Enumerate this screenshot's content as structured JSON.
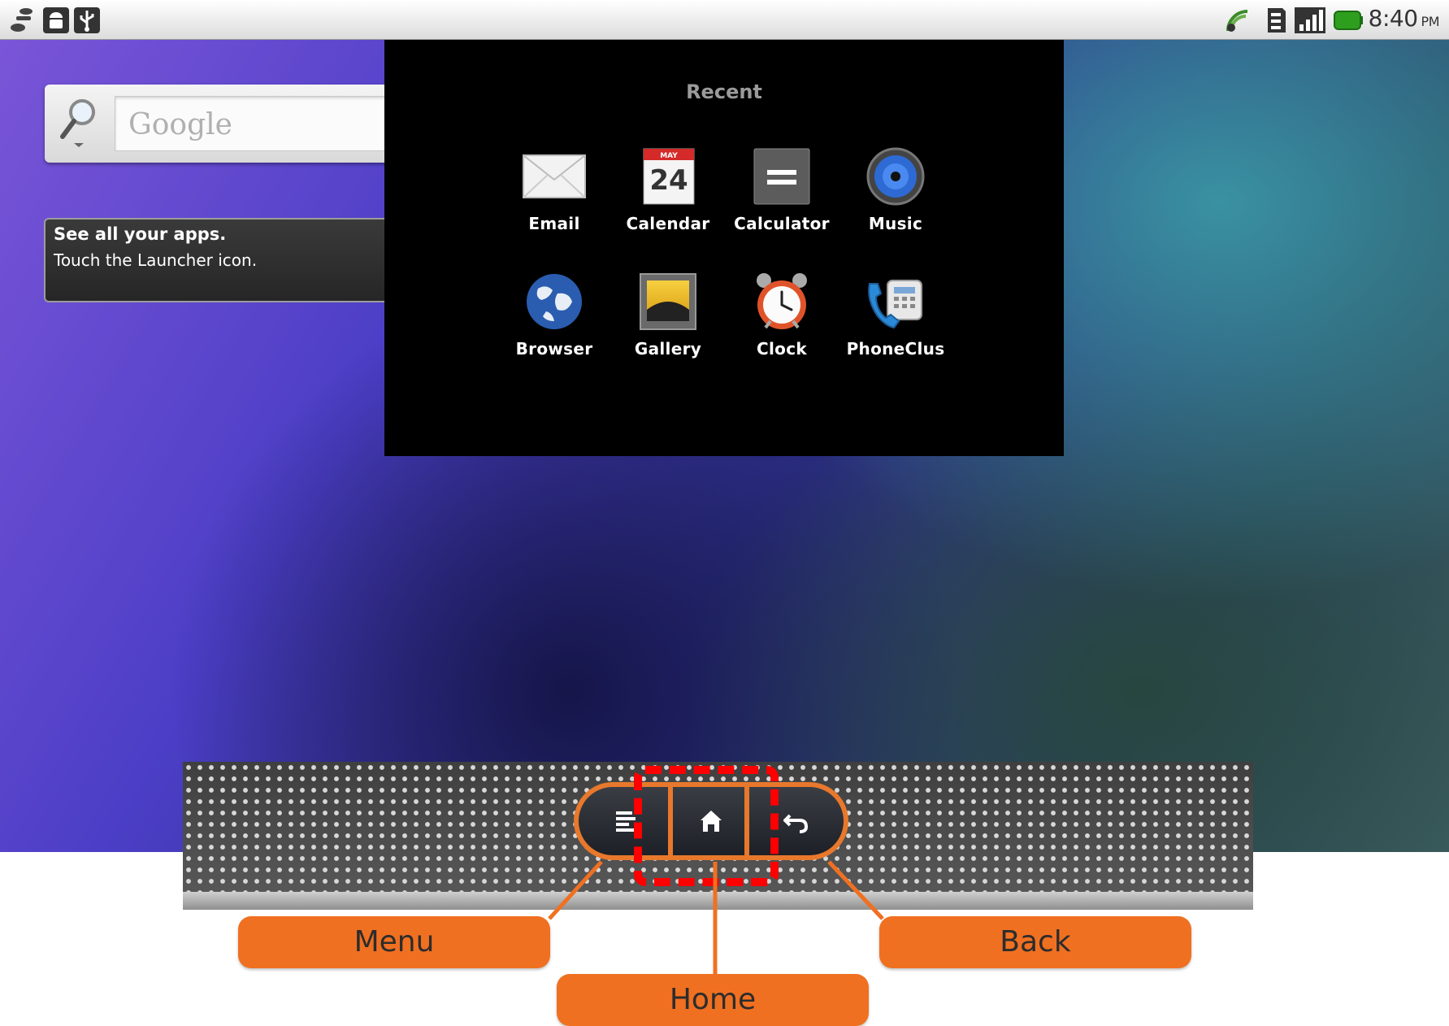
{
  "statusbar": {
    "time": "8:40",
    "ampm": "PM",
    "left_icons": [
      "usb-debug-icon",
      "android-icon",
      "usb-icon"
    ],
    "right_icons": [
      "wifi-signal-icon",
      "sd-card-icon",
      "cell-signal-icon",
      "battery-icon"
    ]
  },
  "search_widget": {
    "placeholder": "Google"
  },
  "tip": {
    "title": "See all your apps.",
    "body": "Touch the Launcher icon."
  },
  "recent": {
    "title": "Recent",
    "apps": [
      {
        "label": "Email",
        "icon": "email-icon"
      },
      {
        "label": "Calendar",
        "icon": "calendar-icon",
        "day": "24",
        "month": "MAY"
      },
      {
        "label": "Calculator",
        "icon": "calculator-icon"
      },
      {
        "label": "Music",
        "icon": "music-icon"
      },
      {
        "label": "Browser",
        "icon": "globe-icon"
      },
      {
        "label": "Gallery",
        "icon": "gallery-icon"
      },
      {
        "label": "Clock",
        "icon": "alarm-clock-icon"
      },
      {
        "label": "PhoneClus",
        "icon": "phone-icon"
      }
    ]
  },
  "device_buttons": {
    "menu_icon": "menu-icon",
    "home_icon": "home-icon",
    "back_icon": "back-icon"
  },
  "callouts": {
    "menu": "Menu",
    "home": "Home",
    "back": "Back"
  },
  "colors": {
    "accent_orange": "#f07021",
    "highlight_red": "#ff0000",
    "dialog_bg": "#000000"
  }
}
